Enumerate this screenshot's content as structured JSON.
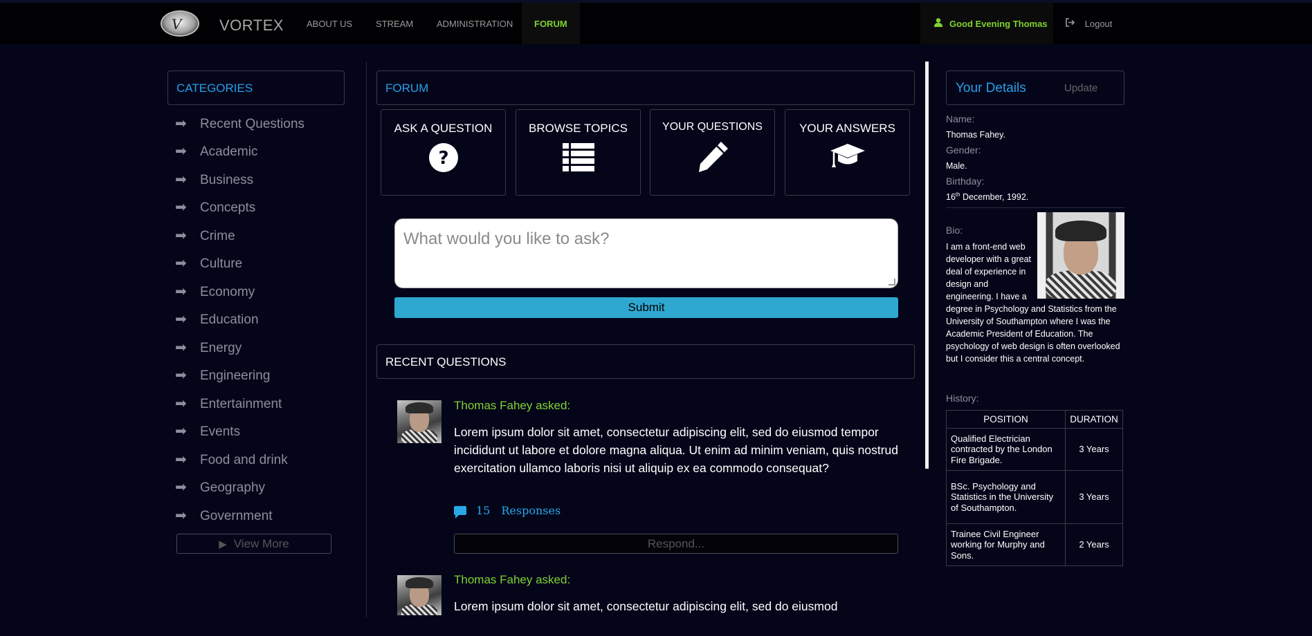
{
  "nav": {
    "brand": "VORTEX",
    "logo_icon": "vortex-logo",
    "items": [
      "ABOUT US",
      "STREAM",
      "ADMINISTRATION",
      "FORUM"
    ],
    "active": "FORUM",
    "greeting": "Good Evening Thomas",
    "logout": "Logout"
  },
  "colors": {
    "accent_green": "#7fd22f",
    "accent_blue": "#28a0e8",
    "submit_blue": "#2fa8d1",
    "background": "#05051a"
  },
  "categories": {
    "title": "CATEGORIES",
    "items": [
      "Recent Questions",
      "Academic",
      "Business",
      "Concepts",
      "Crime",
      "Culture",
      "Economy",
      "Education",
      "Energy",
      "Engineering",
      "Entertainment",
      "Events",
      "Food and drink",
      "Geography",
      "Government"
    ],
    "view_more": "View More"
  },
  "forum": {
    "title": "FORUM",
    "tiles": [
      {
        "label": "ASK A QUESTION",
        "icon": "question-circle-icon"
      },
      {
        "label": "BROWSE TOPICS",
        "icon": "list-icon"
      },
      {
        "label": "YOUR QUESTIONS",
        "icon": "pencil-icon"
      },
      {
        "label": "YOUR ANSWERS",
        "icon": "graduation-cap-icon"
      }
    ],
    "ask_placeholder": "What would you like to ask?",
    "submit": "Submit",
    "recent_title": "RECENT QUESTIONS",
    "questions": [
      {
        "asker": "Thomas Fahey asked:",
        "text": "Lorem ipsum dolor sit amet, consectetur adipiscing elit, sed do eiusmod tempor incididunt ut labore et dolore magna aliqua. Ut enim ad minim veniam, quis nostrud exercitation ullamco laboris nisi ut aliquip ex ea commodo consequat?",
        "responses_count": "15",
        "responses_label": "Responses",
        "respond": "Respond..."
      },
      {
        "asker": "Thomas Fahey asked:",
        "text": "Lorem ipsum dolor sit amet, consectetur adipiscing elit, sed do eiusmod"
      }
    ]
  },
  "details": {
    "title": "Your Details",
    "update": "Update",
    "name_label": "Name:",
    "name": "Thomas Fahey.",
    "gender_label": "Gender:",
    "gender": "Male.",
    "birthday_label": "Birthday:",
    "birthday_day": "16",
    "birthday_suffix": "th",
    "birthday_rest": " December, 1992.",
    "bio_label": "Bio:",
    "bio": "I am a front-end web developer with a great deal of experience in design and engineering. I have a degree in Psychology and Statistics from the University of Southampton where I was the Academic President of Education. The psychology of web design is often overlooked but I consider this a central concept.",
    "history_label": "History:",
    "history_headers": [
      "POSITION",
      "DURATION"
    ],
    "history": [
      {
        "position": "Qualified Electrician contracted by the London Fire Brigade.",
        "duration": "3 Years"
      },
      {
        "position": "BSc. Psychology and Statistics in the University of Southampton.",
        "duration": "3 Years"
      },
      {
        "position": "Trainee Civil Engineer working for Murphy and Sons.",
        "duration": "2 Years"
      }
    ]
  }
}
